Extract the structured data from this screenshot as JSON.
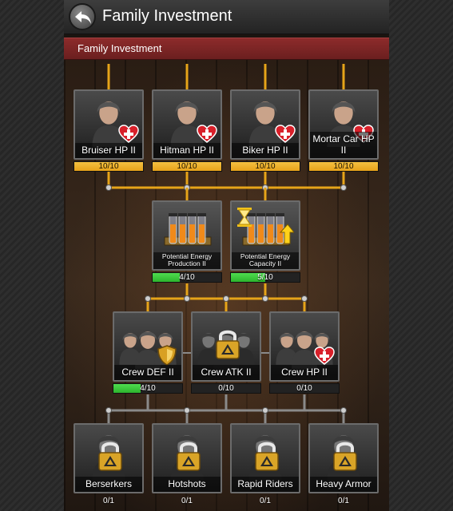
{
  "header": {
    "title": "Family Investment"
  },
  "subheader": {
    "title": "Family Investment"
  },
  "colors": {
    "progress_gold": "#e7a21a",
    "progress_green": "#2db52d",
    "connector": "#e6a419",
    "connector_inactive": "#8a8a8a"
  },
  "tiers": [
    {
      "nodes": [
        {
          "label": "Bruiser HP II",
          "progress": "10/10",
          "fill": 1.0,
          "bar": "gold",
          "icon": "heart-plus-icon",
          "locked": false
        },
        {
          "label": "Hitman HP II",
          "progress": "10/10",
          "fill": 1.0,
          "bar": "gold",
          "icon": "heart-plus-icon",
          "locked": false
        },
        {
          "label": "Biker HP II",
          "progress": "10/10",
          "fill": 1.0,
          "bar": "gold",
          "icon": "heart-plus-icon",
          "locked": false
        },
        {
          "label": "Mortar Car HP II",
          "progress": "10/10",
          "fill": 1.0,
          "bar": "gold",
          "icon": "heart-plus-icon",
          "locked": false
        }
      ]
    },
    {
      "nodes": [
        {
          "label": "Potential Energy Production II",
          "progress": "4/10",
          "fill": 0.4,
          "bar": "green",
          "icon": "energy-tubes-icon",
          "locked": false
        },
        {
          "label": "Potential Energy Capacity II",
          "progress": "5/10",
          "fill": 0.5,
          "bar": "green",
          "icon": "hourglass-up-icon",
          "locked": false
        }
      ]
    },
    {
      "nodes": [
        {
          "label": "Crew DEF II",
          "progress": "4/10",
          "fill": 0.4,
          "bar": "green",
          "icon": "shield-icon",
          "locked": false
        },
        {
          "label": "Crew ATK II",
          "progress": "0/10",
          "fill": 0.0,
          "bar": "green",
          "icon": "lock-icon",
          "locked": true
        },
        {
          "label": "Crew HP II",
          "progress": "0/10",
          "fill": 0.0,
          "bar": "green",
          "icon": "heart-plus-icon",
          "locked": false
        }
      ]
    },
    {
      "nodes": [
        {
          "label": "Berserkers",
          "progress": "0/1",
          "fill": 0.0,
          "bar": "none",
          "icon": "lock-icon",
          "locked": true
        },
        {
          "label": "Hotshots",
          "progress": "0/1",
          "fill": 0.0,
          "bar": "none",
          "icon": "lock-icon",
          "locked": true
        },
        {
          "label": "Rapid Riders",
          "progress": "0/1",
          "fill": 0.0,
          "bar": "none",
          "icon": "lock-icon",
          "locked": true
        },
        {
          "label": "Heavy Armor",
          "progress": "0/1",
          "fill": 0.0,
          "bar": "none",
          "icon": "lock-icon",
          "locked": true
        }
      ]
    }
  ]
}
